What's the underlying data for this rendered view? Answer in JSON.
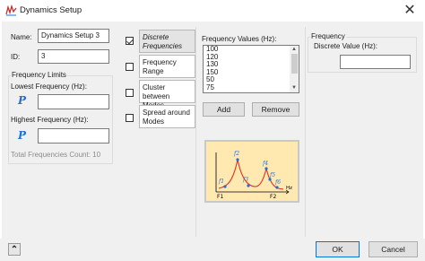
{
  "window": {
    "title": "Dynamics Setup",
    "close_glyph": "✕"
  },
  "general": {
    "name_label": "Name:",
    "name_value": "Dynamics Setup 3",
    "id_label": "ID:",
    "id_value": "3"
  },
  "limits": {
    "group_label": "Frequency Limits",
    "lowest_label": "Lowest Frequency (Hz):",
    "lowest_value": "",
    "highest_label": "Highest Frequency (Hz):",
    "highest_value": "",
    "param_icon_glyph": "P",
    "total_count_label": "Total Frequencies Count: 10"
  },
  "options": [
    {
      "label": "Discrete Frequencies",
      "checked": true,
      "selected": true
    },
    {
      "label": "Frequency Range",
      "checked": false,
      "selected": false
    },
    {
      "label": "Cluster between Modes",
      "checked": false,
      "selected": false
    },
    {
      "label": "Spread around Modes",
      "checked": false,
      "selected": false
    }
  ],
  "values_panel": {
    "label": "Frequency Values (Hz):",
    "values": [
      "100",
      "120",
      "130",
      "150",
      "50",
      "75"
    ],
    "add_label": "Add",
    "remove_label": "Remove"
  },
  "diagram": {
    "peak_labels": [
      "f2",
      "f3",
      "f4",
      "f5"
    ],
    "f1_label": "f1",
    "f6_label": "f6",
    "start_label": "F1",
    "end_label": "F2",
    "axis_unit": "Hz",
    "colors": {
      "curve": "#e03020",
      "points": "#1f6fd1",
      "background": "#ffe9b0",
      "axes": "#000000"
    }
  },
  "frequency_panel": {
    "group_label": "Frequency",
    "discrete_label": "Discrete Value (Hz):",
    "discrete_value": ""
  },
  "footer": {
    "expand_glyph": "⌃",
    "ok_label": "OK",
    "cancel_label": "Cancel"
  }
}
